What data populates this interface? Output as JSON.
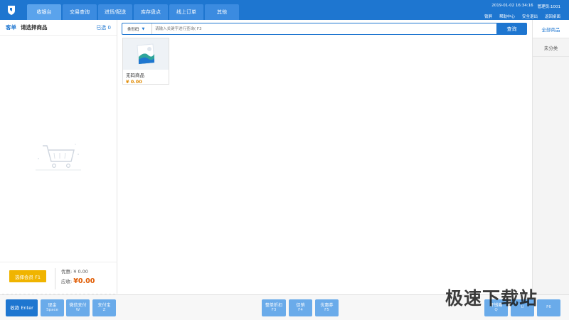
{
  "app": {
    "brand_color": "#1e76d0",
    "logo_icon": "shield-logo-icon"
  },
  "nav": {
    "tabs": [
      {
        "label": "收银台",
        "active": true
      },
      {
        "label": "交易查询",
        "active": false
      },
      {
        "label": "进货/配送",
        "active": false
      },
      {
        "label": "库存盘点",
        "active": false
      },
      {
        "label": "线上订单",
        "active": false
      },
      {
        "label": "其他",
        "active": false
      }
    ]
  },
  "status": {
    "datetime": "2019-01-02 16:34:16",
    "operator": "管理员:1001",
    "links": [
      "锁屏",
      "帮助中心",
      "安全退出",
      "返回桌面"
    ]
  },
  "order": {
    "tag": "客单",
    "title": "请选择商品",
    "selected": "已选 0"
  },
  "checkout": {
    "member_button": "选择会员 F1",
    "discount_label": "优惠: ¥ 0.00",
    "receivable_label": "应收:",
    "receivable_amount": "¥0.00"
  },
  "search": {
    "type": "条形码",
    "placeholder": "请输入关键字进行查询( F3",
    "button": "查询"
  },
  "products": [
    {
      "name": "无码商品",
      "price": "¥ 0.00"
    }
  ],
  "categories": [
    {
      "label": "全部商品",
      "active": true
    },
    {
      "label": "未分类",
      "active": false
    }
  ],
  "function_keys": {
    "pay": {
      "label": "收款",
      "key": "Enter"
    },
    "cash": {
      "label": "现金",
      "key": "Space"
    },
    "wechat": {
      "label": "微信支付",
      "key": "W"
    },
    "alipay": {
      "label": "支付宝",
      "key": "Z"
    },
    "order_discount": {
      "label": "整单折扣",
      "key": "F3"
    },
    "promotion": {
      "label": "促销",
      "key": "F4"
    },
    "coupon": {
      "label": "优惠券",
      "key": "F5"
    },
    "open_drawer": {
      "label": "开钱箱",
      "key": "Q"
    },
    "key_u": {
      "label": "",
      "key": "U"
    },
    "key_f6": {
      "label": "",
      "key": "F6"
    }
  },
  "watermark": "极速下载站"
}
